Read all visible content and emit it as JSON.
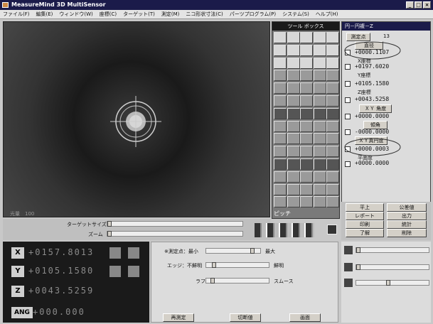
{
  "title": "MeasureMind 3D MultiSensor",
  "window_buttons": [
    "_",
    "□",
    "×"
  ],
  "menu": [
    "ファイル(F)",
    "編集(E)",
    "ウィンドウ(W)",
    "座標(C)",
    "ターゲット(T)",
    "測定(M)",
    "ニコ形状寸法(C)",
    "パーツプログラム(P)",
    "システム(S)",
    "ヘルプ(H)"
  ],
  "camera": {
    "info": "光量　100"
  },
  "toolbox": {
    "title": "ツール ボックス",
    "footer": "ピッチ"
  },
  "target_size": {
    "label": "ターゲットサイズ",
    "zoom_label": "ズーム"
  },
  "coords": [
    {
      "axis": "X",
      "value": "+0157.8013"
    },
    {
      "axis": "Y",
      "value": "+0105.1580"
    },
    {
      "axis": "Z",
      "value": "+0043.5259"
    },
    {
      "axis": "ANG",
      "value": "+000.000"
    }
  ],
  "light": {
    "points_label": "※測定点：最小",
    "points_max": "最大",
    "edge_label": "エッジ：不鮮明",
    "edge_max": "鮮明",
    "rough_label": "ラフ",
    "rough_max": "スムース",
    "buttons": [
      "再測定",
      "切断値",
      "画面"
    ]
  },
  "result": {
    "title": "円－円複－Z",
    "points_label": "測定点",
    "points_value": "13",
    "sub_title": "直径",
    "dia_value": "+0000.1107",
    "x_label": "X座標",
    "x_value": "+0197.6020",
    "y_label": "Y座標",
    "y_value": "+0105.1580",
    "z_label": "Z座標",
    "z_value": "+0043.5258",
    "xy_btn": "ＸＹ 角度",
    "xy_value": "+0000.0000",
    "tilt_btn": "傾角",
    "tilt_value": "-0000.0000",
    "roundness_btn": "ＸＹ真円度",
    "roundness_value": "+0000.0003",
    "flat_label": "平面度",
    "flat_value": "+0000.0000"
  },
  "result_buttons": [
    "平上",
    "公差値",
    "レポート",
    "出力",
    "印刷",
    "統計",
    "了解",
    "削除"
  ]
}
